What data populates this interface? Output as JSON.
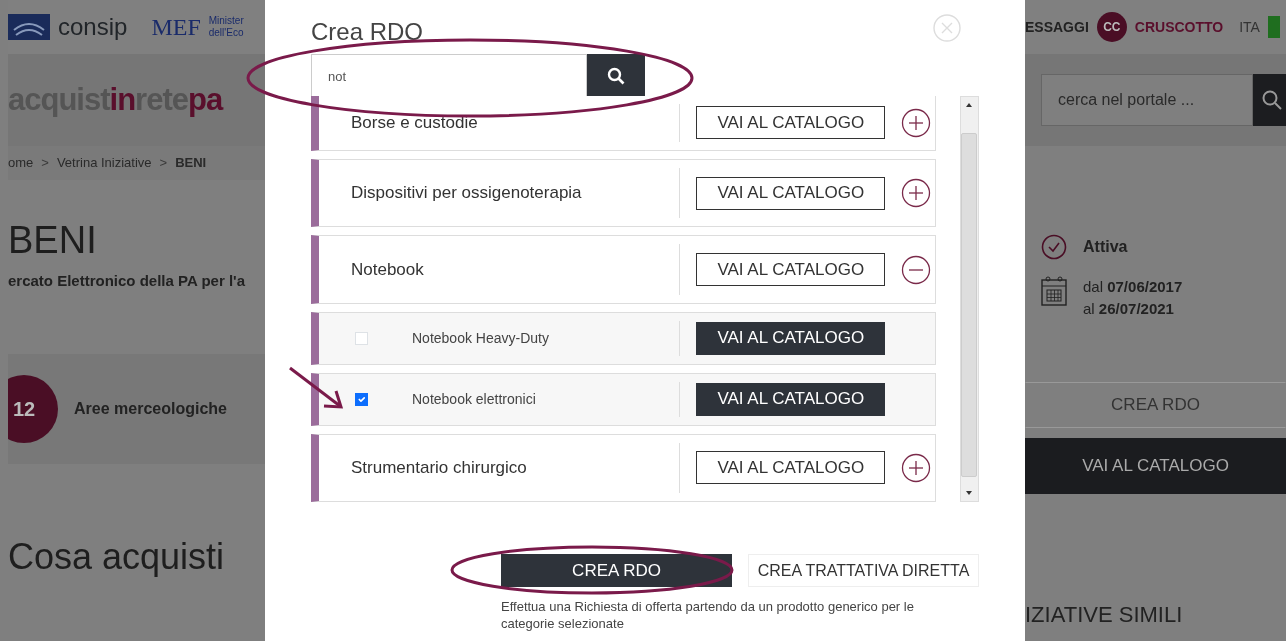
{
  "topbar": {
    "consip_label": "consip",
    "mef_label": "MEF",
    "ministry_lines": [
      "Minister",
      "dell'Eco"
    ],
    "messages_label": "ESSAGGI",
    "avatar_initials": "CC",
    "dashboard_label": "CRUSCOTTO",
    "language": "ITA"
  },
  "portal": {
    "logo_parts": [
      {
        "text": "acquist",
        "accent": false
      },
      {
        "text": "in",
        "accent": true
      },
      {
        "text": "rete",
        "accent": false
      },
      {
        "text": "pa",
        "accent": true
      }
    ],
    "search": {
      "placeholder": "cerca nel portale ..."
    }
  },
  "breadcrumb": {
    "separator": ">",
    "items": [
      {
        "label": "ome",
        "current": false
      },
      {
        "label": "Vetrina Iniziative",
        "current": false
      },
      {
        "label": "BENI",
        "current": true
      }
    ]
  },
  "page": {
    "title": "BENI",
    "subtitle": "ercato Elettronico della PA per l'a",
    "status": "Attiva",
    "date_lines": [
      "dal **07/06/2017**",
      "al **26/07/2021**"
    ],
    "count": "12",
    "count_label": "Aree merceologiche",
    "actions": [
      {
        "label": "CREA RDO",
        "kind": "outline"
      },
      {
        "label": "VAI AL CATALOGO",
        "kind": "dark"
      }
    ],
    "section_title": "Cosa acquisti",
    "side_title": "IZIATIVE SIMILI"
  },
  "modal": {
    "title": "Crea RDO",
    "search": {
      "value": "not"
    },
    "categories": [
      {
        "name": "Borse e custodie",
        "button": "VAI AL CATALOGO",
        "expanded": false
      },
      {
        "name": "Dispositivi per ossigenoterapia",
        "button": "VAI AL CATALOGO",
        "expanded": false
      },
      {
        "name": "Notebook",
        "button": "VAI AL CATALOGO",
        "expanded": true,
        "children": [
          {
            "name": "Notebook Heavy-Duty",
            "button": "VAI AL CATALOGO",
            "checked": false
          },
          {
            "name": "Notebook elettronici",
            "button": "VAI AL CATALOGO",
            "checked": true
          }
        ]
      },
      {
        "name": "Strumentario chirurgico",
        "button": "VAI AL CATALOGO",
        "expanded": false
      }
    ],
    "footer_buttons": [
      {
        "label": "CREA RDO",
        "kind": "dark"
      },
      {
        "label": "CREA TRATTATIVA DIRETTA",
        "kind": "outline"
      }
    ],
    "note": "Effettua una Richiesta di offerta partendo da un prodotto generico per le categorie selezionate"
  }
}
